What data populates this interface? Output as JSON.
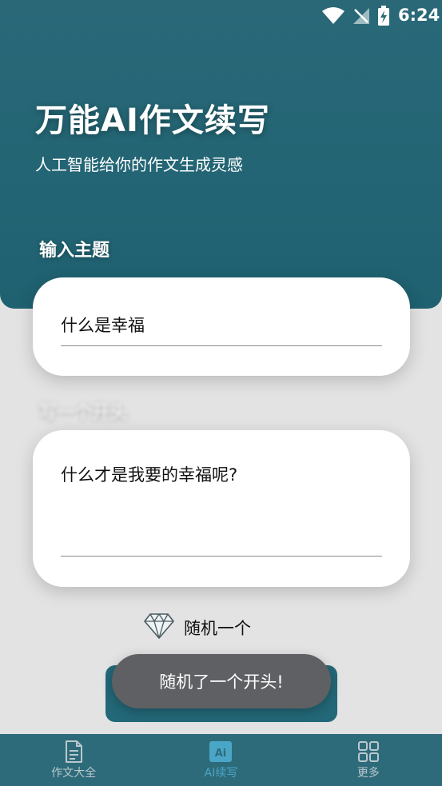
{
  "status": {
    "time": "6:24"
  },
  "header": {
    "title": "万能AI作文续写",
    "subtitle": "人工智能给你的作文生成灵感"
  },
  "topic": {
    "label": "输入主题",
    "value": "什么是幸福"
  },
  "opening": {
    "label": "写一个开头",
    "value": "什么才是我要的幸福呢?"
  },
  "random_link": {
    "label": "随机一个"
  },
  "toast": {
    "message": "随机了一个开头!"
  },
  "bottom_nav": [
    {
      "label": "作文大全",
      "icon": "document-icon",
      "active": false
    },
    {
      "label": "AI续写",
      "icon": "ai-icon",
      "active": true
    },
    {
      "label": "更多",
      "icon": "grid-icon",
      "active": false
    }
  ],
  "colors": {
    "primary": "#236574",
    "nav_bg": "#2e6b7a",
    "nav_active": "#4aa6c7",
    "toast_bg": "#5f6063",
    "page_bg": "#e3e3e3"
  }
}
